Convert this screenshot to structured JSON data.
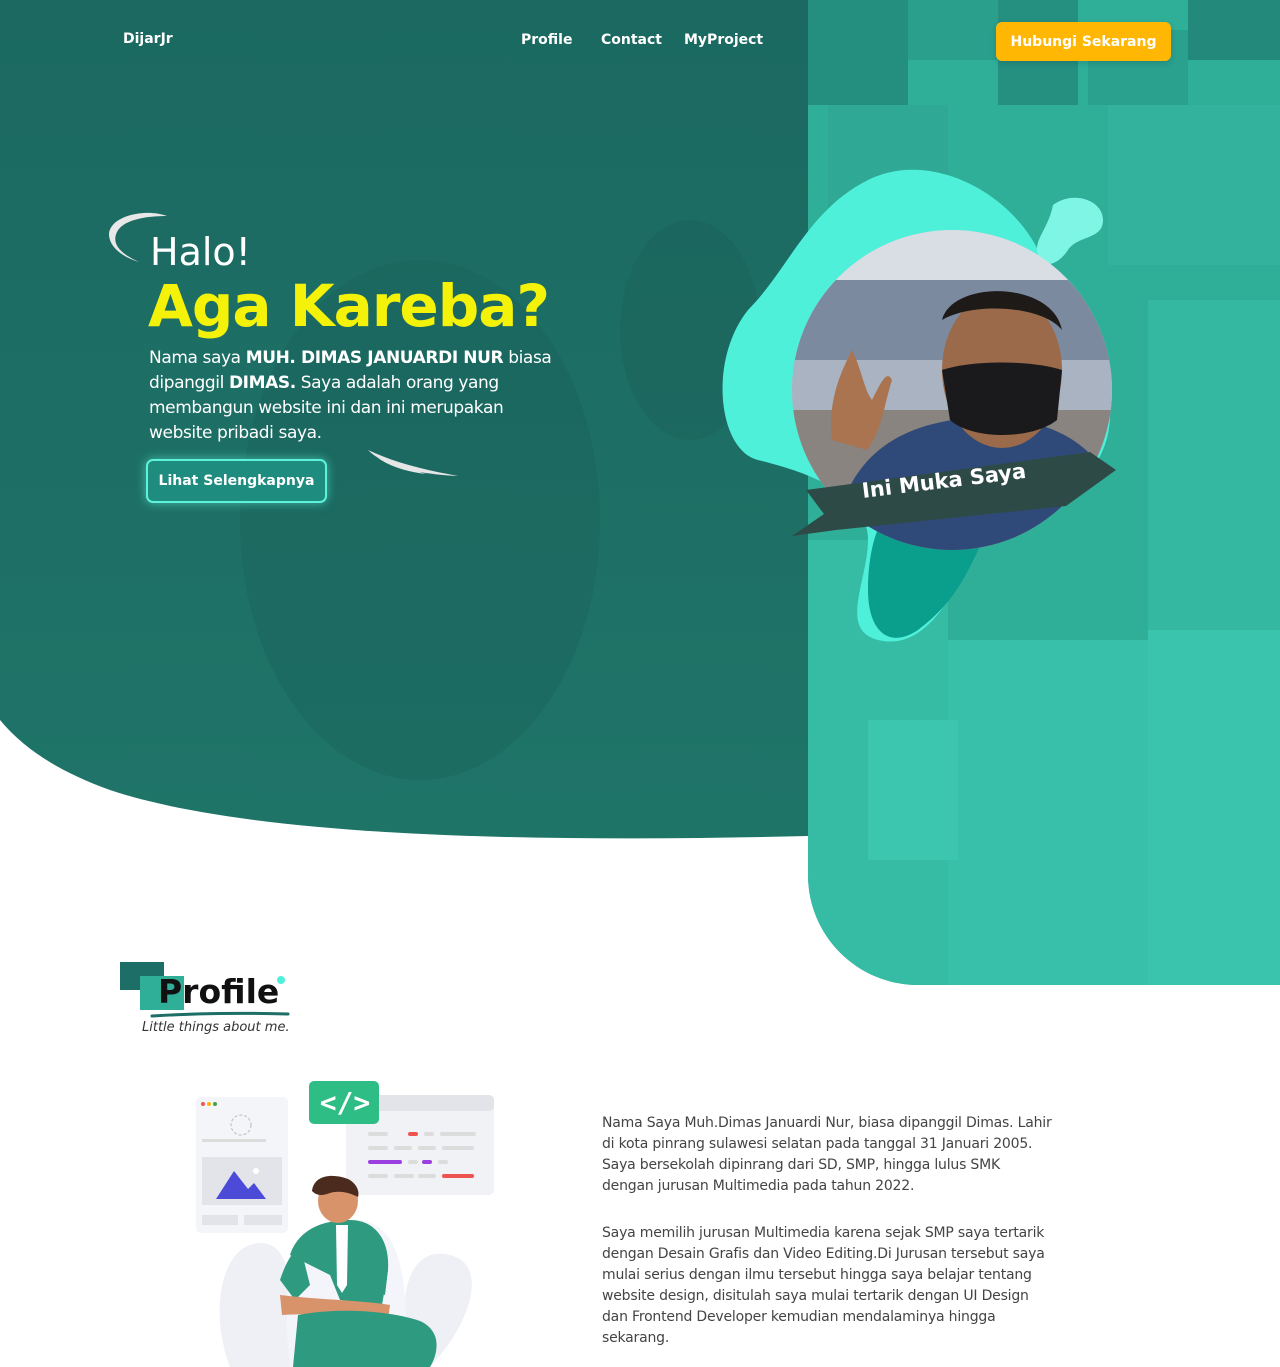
{
  "nav": {
    "logo": "DijarJr",
    "links": [
      "Profile",
      "Contact",
      "MyProject"
    ],
    "cta_label": "Hubungi Sekarang"
  },
  "hero": {
    "greeting": "Halo!",
    "title": "Aga Kareba?",
    "desc_intro": "Nama saya ",
    "desc_name": "MUH. DIMAS JANUARDI NUR",
    "desc_mid": " biasa dipanggil ",
    "desc_nick": "DIMAS.",
    "desc_rest": " Saya adalah orang yang membangun website ini dan ini merupakan website pribadi saya.",
    "button_label": "Lihat Selengkapnya",
    "photo_caption": "Ini Muka Saya"
  },
  "profile": {
    "title": "Profile",
    "subtitle": "Little things about me.",
    "paragraph_1": "Nama Saya Muh.Dimas Januardi Nur, biasa dipanggil Dimas. Lahir di kota pinrang sulawesi selatan pada tanggal 31 Januari 2005. Saya bersekolah dipinrang dari SD, SMP, hingga lulus SMK dengan jurusan Multimedia pada tahun 2022.",
    "paragraph_2": "Saya memilih jurusan Multimedia karena sejak SMP saya tertarik dengan Desain Grafis dan Video Editing.Di Jurusan tersebut saya mulai serius dengan ilmu tersebut hingga saya belajar tentang website design, disitulah saya mulai tertarik dengan UI Design dan Frontend Developer kemudian mendalaminya hingga sekarang.",
    "code_badge": "</>"
  },
  "colors": {
    "hero_bg": "#1d6e66",
    "panel_teal": "#2fae98",
    "accent_yellow": "#f5f20a",
    "cta_orange": "#ffb703",
    "mint": "#4ff0da"
  },
  "icons": [
    "swoosh-icon",
    "code-icon",
    "mountain-image-icon"
  ]
}
